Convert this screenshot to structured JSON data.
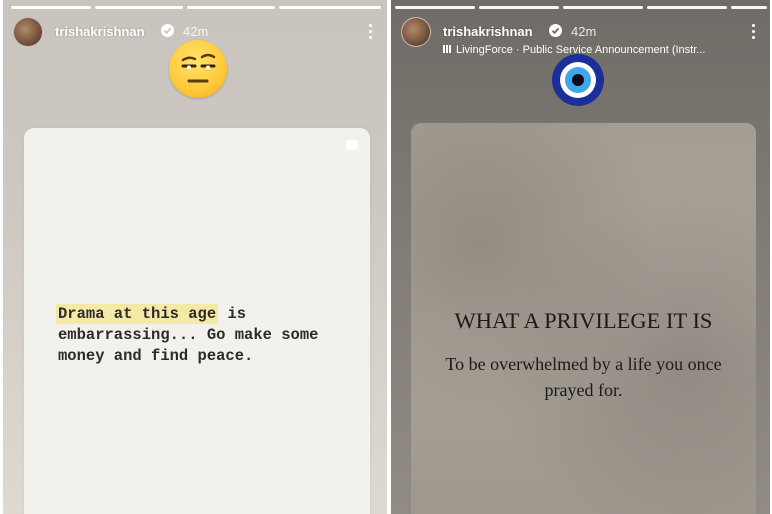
{
  "left_story": {
    "username": "trishakrishnan",
    "time": "42m",
    "sticker": "unamused-face-emoji",
    "note": {
      "highlight": "Drama at this age",
      "rest": " is embarrassing... Go make some money and find peace."
    }
  },
  "right_story": {
    "username": "trishakrishnan",
    "time": "42m",
    "music": "LivingForce · Public Service Announcement (Instr...",
    "sticker": "evil-eye-emoji",
    "quote": {
      "title": "WHAT A PRIVILEGE IT IS",
      "body": "To be overwhelmed by a life you once prayed for."
    }
  },
  "colors": {
    "highlight": "#f5e9a6",
    "evil_eye_blue": "#1a2f9a"
  }
}
